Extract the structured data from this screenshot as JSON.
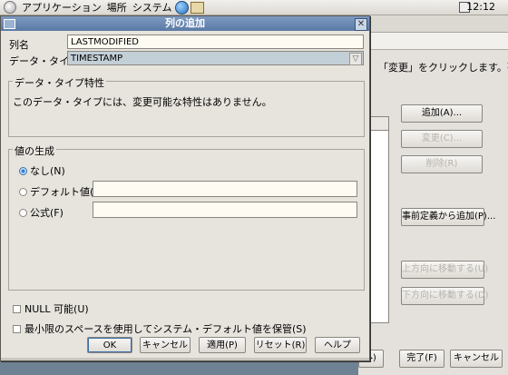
{
  "panel": {
    "menus": [
      "アプリケーション",
      "場所",
      "システム"
    ],
    "clock": "12:12"
  },
  "background_window": {
    "instruction_text": "「変更」をクリックします。列を",
    "buttons": {
      "add": "追加(A)...",
      "change": "変更(C)...",
      "delete": "削除(R)",
      "add_predefined": "事前定義から追加(P)...",
      "move_up": "上方向に移動する(U)",
      "move_down": "下方向に移動する(D)",
      "next": "▶)",
      "finish": "完了(F)",
      "cancel": "キャンセル"
    }
  },
  "dialog": {
    "title": "列の追加",
    "column_name_label": "列名",
    "column_name_value": "LASTMODIFIED",
    "data_type_label": "データ・タイプ",
    "data_type_value": "TIMESTAMP",
    "properties_group": {
      "legend": "データ・タイプ特性",
      "message": "このデータ・タイプには、変更可能な特性はありません。"
    },
    "value_generation_group": {
      "legend": "値の生成",
      "options": {
        "none": "なし(N)",
        "default": "デフォルト値(D)",
        "formula": "公式(F)"
      },
      "selected": "none",
      "default_value": "",
      "formula_value": ""
    },
    "nullable_label": "NULL 可能(U)",
    "compress_label": "最小限のスペースを使用してシステム・デフォルト値を保管(S)",
    "buttons": {
      "ok": "OK",
      "cancel": "キャンセル",
      "apply": "適用(P)",
      "reset": "リセット(R)",
      "help": "ヘルプ"
    }
  }
}
